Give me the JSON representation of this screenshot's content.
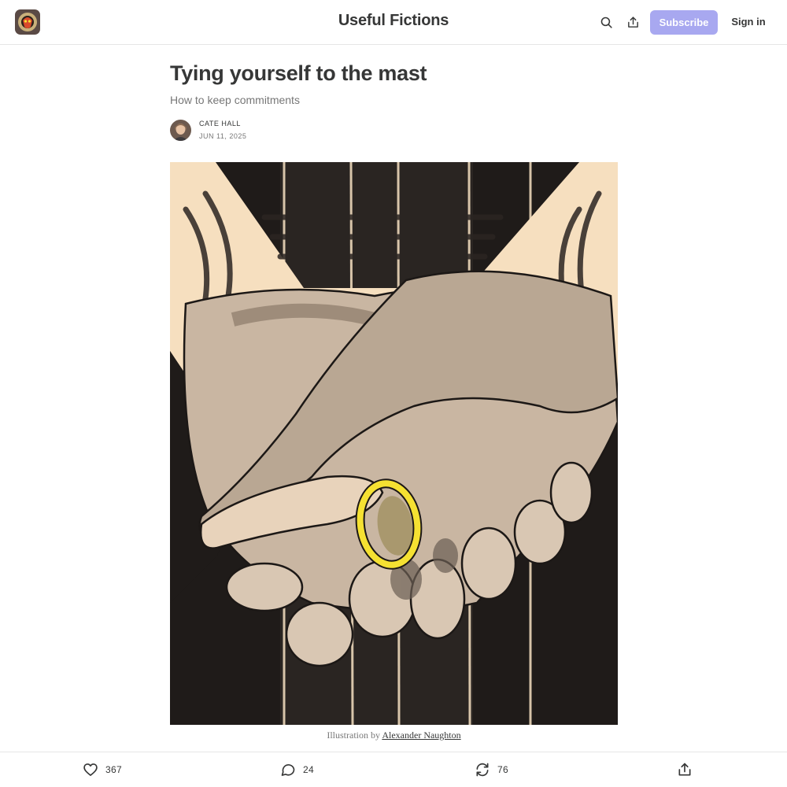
{
  "header": {
    "publication_name": "Useful Fictions",
    "subscribe_label": "Subscribe",
    "signin_label": "Sign in",
    "search_icon": "search-icon",
    "share_icon": "share-icon"
  },
  "post": {
    "title": "Tying yourself to the mast",
    "subtitle": "How to keep commitments",
    "author": "CATE HALL",
    "date": "JUN 11, 2025",
    "caption_prefix": "Illustration by ",
    "caption_credit": "Alexander Naughton"
  },
  "actions": {
    "likes": "367",
    "comments": "24",
    "restacks": "76"
  },
  "colors": {
    "accent": "#a8a8f0",
    "text": "#363737",
    "muted": "#777777",
    "ring": "#f5e132"
  }
}
